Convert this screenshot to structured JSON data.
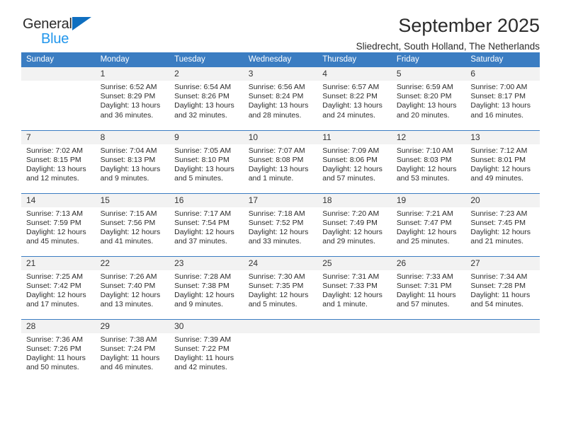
{
  "brand": {
    "name_top": "General",
    "name_bottom": "Blue",
    "triangle_color": "#0f6fc0",
    "blue_text_color": "#2196ec"
  },
  "header": {
    "title": "September 2025",
    "subtitle": "Sliedrecht, South Holland, The Netherlands"
  },
  "theme": {
    "header_blue": "#3b7dc2",
    "daynum_band": "#f2f2f2",
    "grid_line": "#3b7dc2"
  },
  "weekdays": [
    "Sunday",
    "Monday",
    "Tuesday",
    "Wednesday",
    "Thursday",
    "Friday",
    "Saturday"
  ],
  "weeks": [
    [
      {
        "day": "",
        "sunrise": "",
        "sunset": "",
        "daylight1": "",
        "daylight2": "",
        "empty": true
      },
      {
        "day": "1",
        "sunrise": "Sunrise: 6:52 AM",
        "sunset": "Sunset: 8:29 PM",
        "daylight1": "Daylight: 13 hours",
        "daylight2": "and 36 minutes."
      },
      {
        "day": "2",
        "sunrise": "Sunrise: 6:54 AM",
        "sunset": "Sunset: 8:26 PM",
        "daylight1": "Daylight: 13 hours",
        "daylight2": "and 32 minutes."
      },
      {
        "day": "3",
        "sunrise": "Sunrise: 6:56 AM",
        "sunset": "Sunset: 8:24 PM",
        "daylight1": "Daylight: 13 hours",
        "daylight2": "and 28 minutes."
      },
      {
        "day": "4",
        "sunrise": "Sunrise: 6:57 AM",
        "sunset": "Sunset: 8:22 PM",
        "daylight1": "Daylight: 13 hours",
        "daylight2": "and 24 minutes."
      },
      {
        "day": "5",
        "sunrise": "Sunrise: 6:59 AM",
        "sunset": "Sunset: 8:20 PM",
        "daylight1": "Daylight: 13 hours",
        "daylight2": "and 20 minutes."
      },
      {
        "day": "6",
        "sunrise": "Sunrise: 7:00 AM",
        "sunset": "Sunset: 8:17 PM",
        "daylight1": "Daylight: 13 hours",
        "daylight2": "and 16 minutes."
      }
    ],
    [
      {
        "day": "7",
        "sunrise": "Sunrise: 7:02 AM",
        "sunset": "Sunset: 8:15 PM",
        "daylight1": "Daylight: 13 hours",
        "daylight2": "and 12 minutes."
      },
      {
        "day": "8",
        "sunrise": "Sunrise: 7:04 AM",
        "sunset": "Sunset: 8:13 PM",
        "daylight1": "Daylight: 13 hours",
        "daylight2": "and 9 minutes."
      },
      {
        "day": "9",
        "sunrise": "Sunrise: 7:05 AM",
        "sunset": "Sunset: 8:10 PM",
        "daylight1": "Daylight: 13 hours",
        "daylight2": "and 5 minutes."
      },
      {
        "day": "10",
        "sunrise": "Sunrise: 7:07 AM",
        "sunset": "Sunset: 8:08 PM",
        "daylight1": "Daylight: 13 hours",
        "daylight2": "and 1 minute."
      },
      {
        "day": "11",
        "sunrise": "Sunrise: 7:09 AM",
        "sunset": "Sunset: 8:06 PM",
        "daylight1": "Daylight: 12 hours",
        "daylight2": "and 57 minutes."
      },
      {
        "day": "12",
        "sunrise": "Sunrise: 7:10 AM",
        "sunset": "Sunset: 8:03 PM",
        "daylight1": "Daylight: 12 hours",
        "daylight2": "and 53 minutes."
      },
      {
        "day": "13",
        "sunrise": "Sunrise: 7:12 AM",
        "sunset": "Sunset: 8:01 PM",
        "daylight1": "Daylight: 12 hours",
        "daylight2": "and 49 minutes."
      }
    ],
    [
      {
        "day": "14",
        "sunrise": "Sunrise: 7:13 AM",
        "sunset": "Sunset: 7:59 PM",
        "daylight1": "Daylight: 12 hours",
        "daylight2": "and 45 minutes."
      },
      {
        "day": "15",
        "sunrise": "Sunrise: 7:15 AM",
        "sunset": "Sunset: 7:56 PM",
        "daylight1": "Daylight: 12 hours",
        "daylight2": "and 41 minutes."
      },
      {
        "day": "16",
        "sunrise": "Sunrise: 7:17 AM",
        "sunset": "Sunset: 7:54 PM",
        "daylight1": "Daylight: 12 hours",
        "daylight2": "and 37 minutes."
      },
      {
        "day": "17",
        "sunrise": "Sunrise: 7:18 AM",
        "sunset": "Sunset: 7:52 PM",
        "daylight1": "Daylight: 12 hours",
        "daylight2": "and 33 minutes."
      },
      {
        "day": "18",
        "sunrise": "Sunrise: 7:20 AM",
        "sunset": "Sunset: 7:49 PM",
        "daylight1": "Daylight: 12 hours",
        "daylight2": "and 29 minutes."
      },
      {
        "day": "19",
        "sunrise": "Sunrise: 7:21 AM",
        "sunset": "Sunset: 7:47 PM",
        "daylight1": "Daylight: 12 hours",
        "daylight2": "and 25 minutes."
      },
      {
        "day": "20",
        "sunrise": "Sunrise: 7:23 AM",
        "sunset": "Sunset: 7:45 PM",
        "daylight1": "Daylight: 12 hours",
        "daylight2": "and 21 minutes."
      }
    ],
    [
      {
        "day": "21",
        "sunrise": "Sunrise: 7:25 AM",
        "sunset": "Sunset: 7:42 PM",
        "daylight1": "Daylight: 12 hours",
        "daylight2": "and 17 minutes."
      },
      {
        "day": "22",
        "sunrise": "Sunrise: 7:26 AM",
        "sunset": "Sunset: 7:40 PM",
        "daylight1": "Daylight: 12 hours",
        "daylight2": "and 13 minutes."
      },
      {
        "day": "23",
        "sunrise": "Sunrise: 7:28 AM",
        "sunset": "Sunset: 7:38 PM",
        "daylight1": "Daylight: 12 hours",
        "daylight2": "and 9 minutes."
      },
      {
        "day": "24",
        "sunrise": "Sunrise: 7:30 AM",
        "sunset": "Sunset: 7:35 PM",
        "daylight1": "Daylight: 12 hours",
        "daylight2": "and 5 minutes."
      },
      {
        "day": "25",
        "sunrise": "Sunrise: 7:31 AM",
        "sunset": "Sunset: 7:33 PM",
        "daylight1": "Daylight: 12 hours",
        "daylight2": "and 1 minute."
      },
      {
        "day": "26",
        "sunrise": "Sunrise: 7:33 AM",
        "sunset": "Sunset: 7:31 PM",
        "daylight1": "Daylight: 11 hours",
        "daylight2": "and 57 minutes."
      },
      {
        "day": "27",
        "sunrise": "Sunrise: 7:34 AM",
        "sunset": "Sunset: 7:28 PM",
        "daylight1": "Daylight: 11 hours",
        "daylight2": "and 54 minutes."
      }
    ],
    [
      {
        "day": "28",
        "sunrise": "Sunrise: 7:36 AM",
        "sunset": "Sunset: 7:26 PM",
        "daylight1": "Daylight: 11 hours",
        "daylight2": "and 50 minutes."
      },
      {
        "day": "29",
        "sunrise": "Sunrise: 7:38 AM",
        "sunset": "Sunset: 7:24 PM",
        "daylight1": "Daylight: 11 hours",
        "daylight2": "and 46 minutes."
      },
      {
        "day": "30",
        "sunrise": "Sunrise: 7:39 AM",
        "sunset": "Sunset: 7:22 PM",
        "daylight1": "Daylight: 11 hours",
        "daylight2": "and 42 minutes."
      },
      {
        "day": "",
        "sunrise": "",
        "sunset": "",
        "daylight1": "",
        "daylight2": "",
        "empty": true
      },
      {
        "day": "",
        "sunrise": "",
        "sunset": "",
        "daylight1": "",
        "daylight2": "",
        "empty": true
      },
      {
        "day": "",
        "sunrise": "",
        "sunset": "",
        "daylight1": "",
        "daylight2": "",
        "empty": true
      },
      {
        "day": "",
        "sunrise": "",
        "sunset": "",
        "daylight1": "",
        "daylight2": "",
        "empty": true
      }
    ]
  ]
}
